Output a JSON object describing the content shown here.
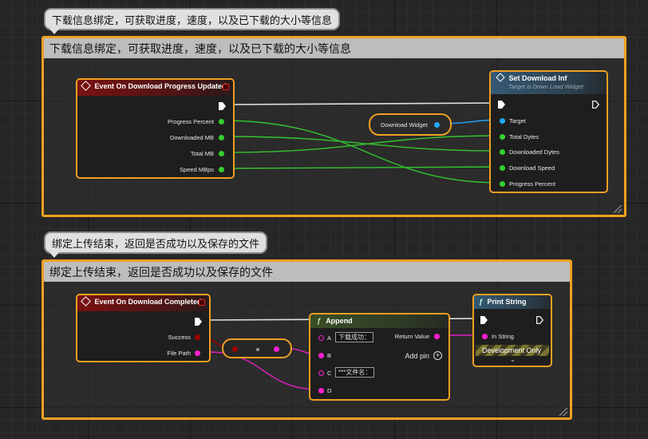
{
  "comments": [
    {
      "bubble": "下载信息绑定，可获取进度，速度，以及已下载的大小等信息",
      "title": "下载信息绑定，可获取进度，速度，以及已下载的大小等信息"
    },
    {
      "bubble": "绑定上传结束，返回是否成功以及保存的文件",
      "title": "绑定上传结束，返回是否成功以及保存的文件"
    }
  ],
  "event_progress": {
    "title": "Event On Download Progress Updated",
    "pins": [
      "Progress Percent",
      "Downloaded MB",
      "Total MB",
      "Speed MBps"
    ]
  },
  "download_widget": {
    "label": "Download Widget"
  },
  "set_download": {
    "title": "Set Download Inf",
    "subtitle": "Target is Down Load Widget",
    "pins": [
      "Target",
      "Total Dytes",
      "Downloaded Dytes",
      "Download Speed",
      "Progress Percent"
    ]
  },
  "event_completed": {
    "title": "Event On Download Completed",
    "pins": [
      "Success",
      "File Path"
    ]
  },
  "append": {
    "title": "Append",
    "pins": [
      "A",
      "B",
      "C",
      "D"
    ],
    "a_value": "下载成功：",
    "c_value": "***文件名：",
    "return_label": "Return Value",
    "add_pin": "Add pin"
  },
  "print_string": {
    "title": "Print String",
    "in_string": "In String",
    "dev_only": "Development Only"
  },
  "colors": {
    "comment_border": "#f0a020",
    "float_pin": "#34d130",
    "object_pin": "#20a8ff",
    "string_pin": "#ff1fd0",
    "bool_pin": "#a00000"
  }
}
